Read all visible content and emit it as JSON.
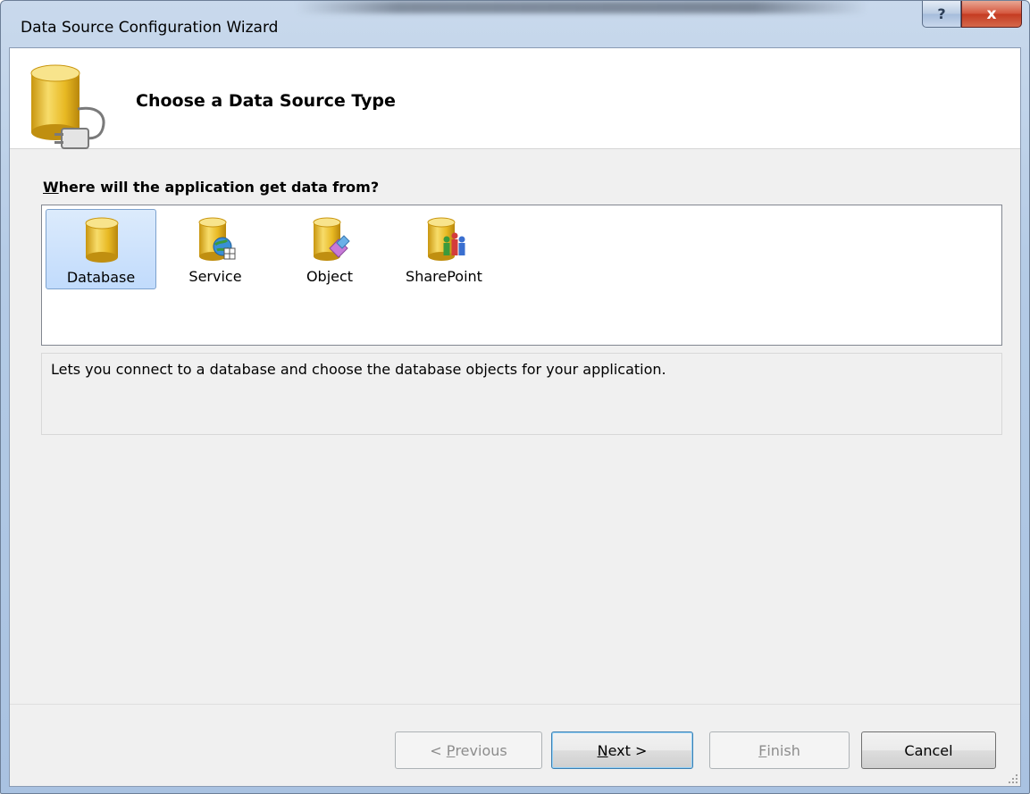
{
  "window": {
    "title": "Data Source Configuration Wizard",
    "help_glyph": "?",
    "close_glyph": "x"
  },
  "header": {
    "title": "Choose a Data Source Type",
    "icon": "database-plug-icon"
  },
  "question": {
    "accel": "W",
    "rest": "here will the application get data from?"
  },
  "sources": [
    {
      "label": "Database",
      "icon": "database-icon",
      "selected": true
    },
    {
      "label": "Service",
      "icon": "database-service-icon",
      "selected": false
    },
    {
      "label": "Object",
      "icon": "database-object-icon",
      "selected": false
    },
    {
      "label": "SharePoint",
      "icon": "database-sharepoint-icon",
      "selected": false
    }
  ],
  "description": "Lets you connect to a database and choose the database objects for your application.",
  "buttons": {
    "previous": {
      "pre": "< ",
      "accel": "P",
      "rest": "revious",
      "enabled": false
    },
    "next": {
      "accel": "N",
      "rest": "ext >",
      "enabled": true
    },
    "finish": {
      "accel": "F",
      "rest": "inish",
      "enabled": false
    },
    "cancel": {
      "label": "Cancel",
      "enabled": true
    }
  },
  "colors": {
    "selection_fill": "#c1dbfc",
    "db_gold": "#e8b923",
    "default_button_border": "#3c7fb1"
  }
}
